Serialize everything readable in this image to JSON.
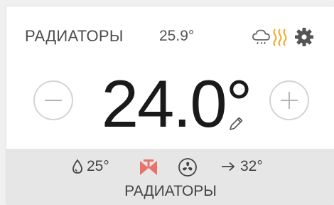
{
  "header": {
    "title": "РАДИАТОРЫ",
    "current_temp": "25.9°"
  },
  "setpoint": {
    "value": "24.0°"
  },
  "footer": {
    "water_temp": "25°",
    "outlet_temp": "32°",
    "label": "РАДИАТОРЫ"
  },
  "colors": {
    "heat_accent": "#f5a623",
    "valve_accent": "#e8736b"
  },
  "icons": {
    "weather": "cloud-rain-snow-icon",
    "heat": "heating-waves-icon",
    "settings": "gear-icon",
    "edit": "pencil-icon",
    "water": "drop-icon",
    "valve": "valve-icon",
    "fan": "fan-icon",
    "outlet": "arrow-right-icon"
  }
}
